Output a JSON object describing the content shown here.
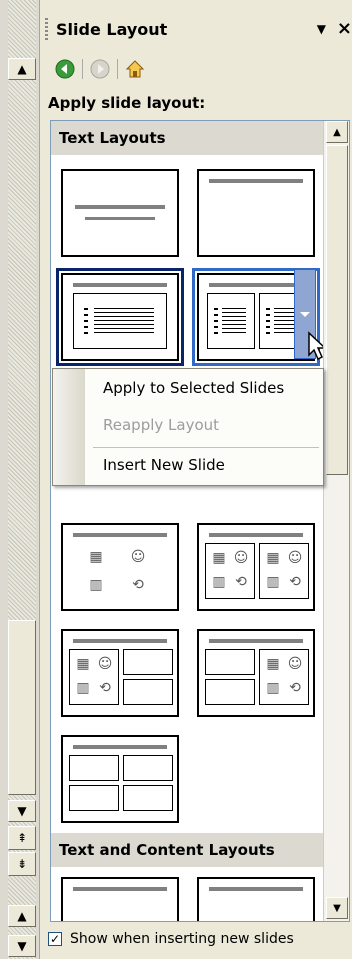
{
  "task_pane": {
    "title": "Slide Layout",
    "menu_arrow": "▼",
    "close_glyph": "×",
    "apply_label": "Apply slide layout:",
    "sections": [
      "Text Layouts",
      "Text and Content Layouts"
    ]
  },
  "context_menu": {
    "items": [
      {
        "label": "Apply to Selected Slides",
        "enabled": true
      },
      {
        "label": "Reapply Layout",
        "enabled": false
      },
      {
        "label": "Insert New Slide",
        "enabled": true
      }
    ]
  },
  "footer": {
    "checkbox_label": "Show when inserting new slides",
    "checked": true,
    "check_glyph": "✓"
  },
  "icons": {
    "back": "back-arrow-icon",
    "forward": "forward-arrow-icon",
    "home": "home-icon"
  },
  "colors": {
    "selection": "#0a246a",
    "hover": "#316ac5",
    "pane_bg": "#ece9d8"
  }
}
